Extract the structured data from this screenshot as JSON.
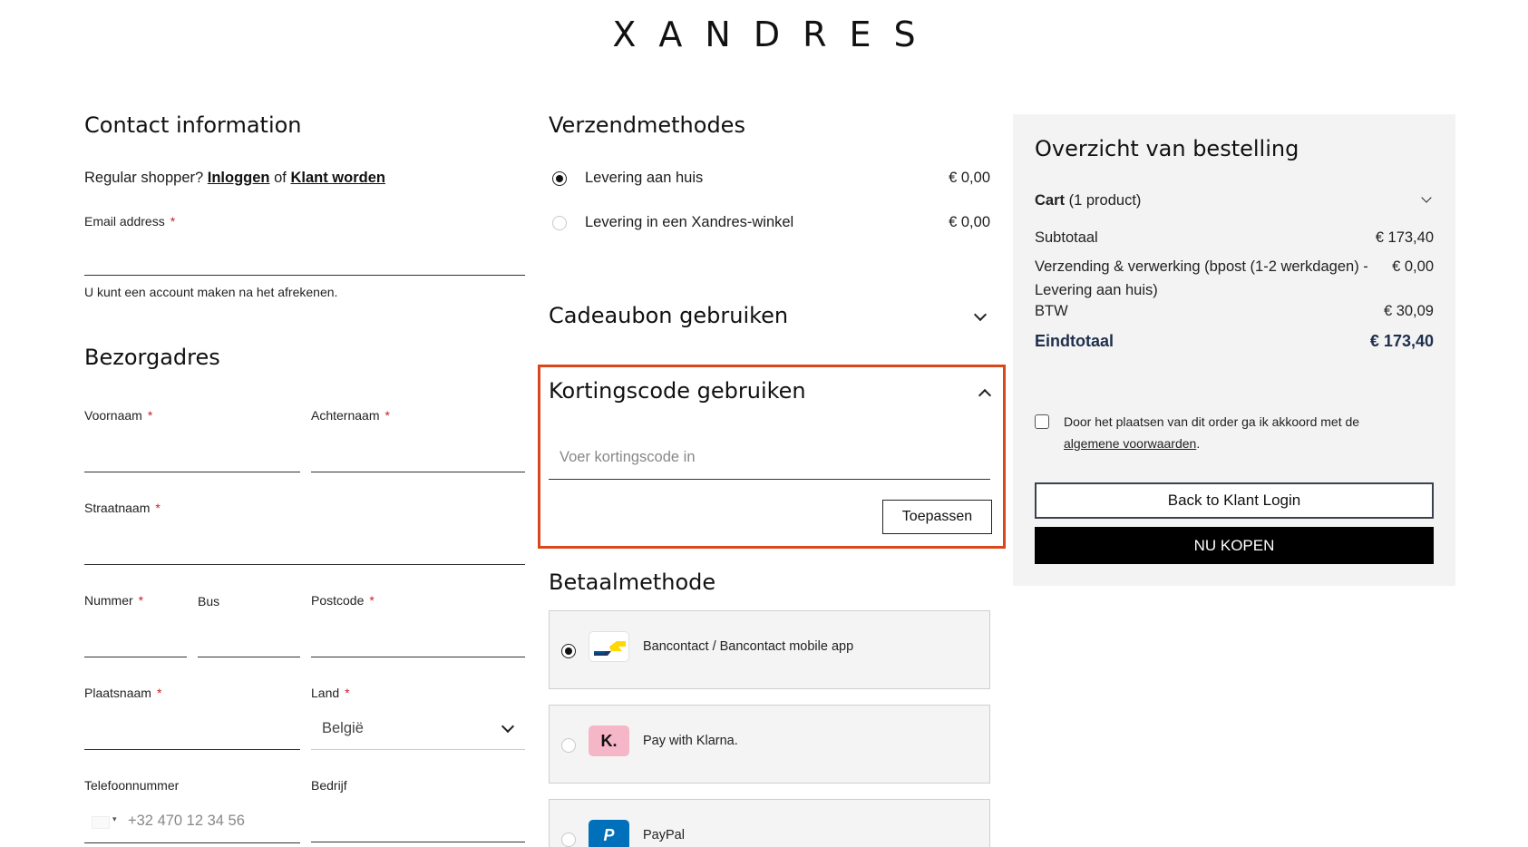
{
  "brand": {
    "logo": "XANDRES"
  },
  "contact": {
    "title": "Contact information",
    "shopper_prefix": "Regular shopper?",
    "login_link": "Inloggen",
    "or": "of",
    "register_link": "Klant worden",
    "email_label": "Email address",
    "account_note": "U kunt een account maken na het afrekenen."
  },
  "address": {
    "title": "Bezorgadres",
    "firstname_label": "Voornaam",
    "lastname_label": "Achternaam",
    "street_label": "Straatnaam",
    "number_label": "Nummer",
    "bus_label": "Bus",
    "postcode_label": "Postcode",
    "city_label": "Plaatsnaam",
    "country_label": "Land",
    "country_value": "België",
    "phone_label": "Telefoonnummer",
    "phone_placeholder": "+32 470 12 34 56",
    "company_label": "Bedrijf",
    "required_mark": "*"
  },
  "shipping": {
    "title": "Verzendmethodes",
    "options": [
      {
        "label": "Levering aan huis",
        "price": "€ 0,00",
        "selected": true
      },
      {
        "label": "Levering in een Xandres-winkel",
        "price": "€ 0,00",
        "selected": false
      }
    ]
  },
  "giftcard": {
    "title": "Cadeaubon gebruiken"
  },
  "discount": {
    "title": "Kortingscode gebruiken",
    "placeholder": "Voer kortingscode in",
    "apply_label": "Toepassen",
    "highlight_color": "#d9481c"
  },
  "payment": {
    "title": "Betaalmethode",
    "methods": [
      {
        "label": "Bancontact / Bancontact mobile app",
        "icon": "bancontact-logo",
        "selected": true
      },
      {
        "label": "Pay with Klarna.",
        "icon": "klarna-logo",
        "badge": "K.",
        "selected": false
      },
      {
        "label": "PayPal",
        "icon": "paypal-logo",
        "badge": "P",
        "selected": false
      }
    ]
  },
  "summary": {
    "title": "Overzicht van bestelling",
    "cart_label": "Cart",
    "cart_count": "(1 product)",
    "subtotal_label": "Subtotaal",
    "subtotal_value": "€ 173,40",
    "shipping_label": "Verzending & verwerking (bpost (1-2 werkdagen) - Levering aan huis)",
    "shipping_value": "€ 0,00",
    "tax_label": "BTW",
    "tax_value": "€ 30,09",
    "total_label": "Eindtotaal",
    "total_value": "€ 173,40",
    "terms_text": "Door het plaatsen van dit order ga ik akkoord met de",
    "terms_link": "algemene voorwaarden",
    "terms_end": ".",
    "back_button": "Back to Klant Login",
    "buy_button": "NU KOPEN"
  }
}
